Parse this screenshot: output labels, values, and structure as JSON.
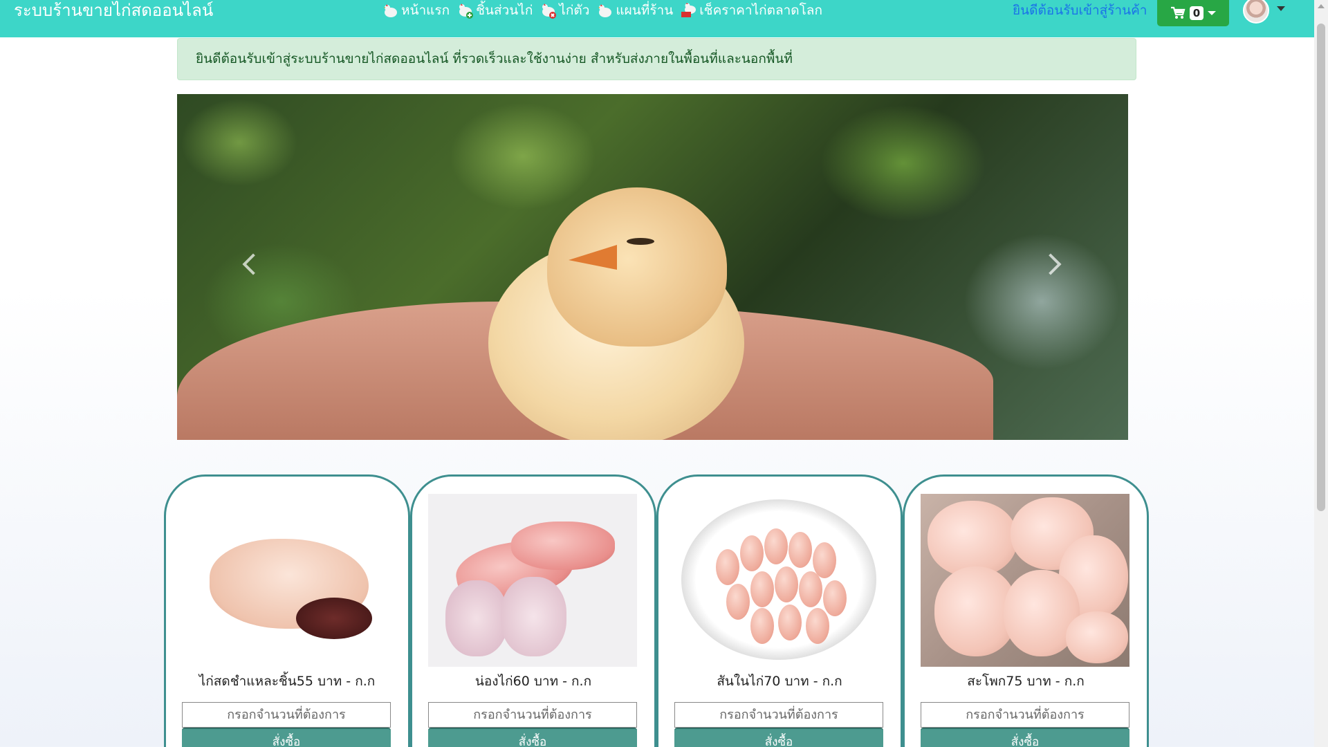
{
  "navbar": {
    "brand": "ระบบร้านขายไก่สดออนไลน์",
    "links": [
      {
        "label": "หน้าแรก",
        "icon": "hen-icon"
      },
      {
        "label": "ชิ้นส่วนไก่",
        "icon": "hen-plus-icon"
      },
      {
        "label": "ไก่ตัว",
        "icon": "hen-x-icon"
      },
      {
        "label": "แผนที่ร้าน",
        "icon": "hen-icon"
      },
      {
        "label": "เช็คราคาไก่ตลาดโลก",
        "icon": "hen-cart-icon"
      }
    ],
    "welcome": "ยินดีต้อนรับเข้าสู่ร้านค้า",
    "cart_count": "0",
    "colors": {
      "bar": "#3dd6c8",
      "cart_button": "#28a745",
      "welcome_link": "#1a73e8"
    }
  },
  "alert": {
    "text": "ยินดีต้อนรับเข้าสู่ระบบร้านขายไก่สดออนไลน์ ที่รวดเร็วและใช้งานง่าย สำหรับส่งภายในพื้อนที่และนอกพื้นที่"
  },
  "carousel": {
    "image": "chick-in-hand-photo",
    "prev_icon": "chevron-left-icon",
    "next_icon": "chevron-right-icon"
  },
  "products": [
    {
      "name": "ไก่สดชำแหละชิ้น55 บาท - ก.ก",
      "image": "whole-chicken-photo",
      "placeholder": "กรอกจำนวนที่ต้องการ",
      "button": "สั่งซื้อ"
    },
    {
      "name": "น่องไก่60 บาท - ก.ก",
      "image": "chicken-thigh-photo",
      "placeholder": "กรอกจำนวนที่ต้องการ",
      "button": "สั่งซื้อ"
    },
    {
      "name": "สันในไก่70 บาท - ก.ก",
      "image": "chicken-tenderloin-photo",
      "placeholder": "กรอกจำนวนที่ต้องการ",
      "button": "สั่งซื้อ"
    },
    {
      "name": "สะโพก75 บาท - ก.ก",
      "image": "chicken-leg-quarter-photo",
      "placeholder": "กรอกจำนวนที่ต้องการ",
      "button": "สั่งซื้อ"
    }
  ],
  "theme": {
    "card_border": "#3e8f8f",
    "order_button": "#4d9b90",
    "alert_bg": "#d4edda",
    "alert_text": "#155724"
  }
}
